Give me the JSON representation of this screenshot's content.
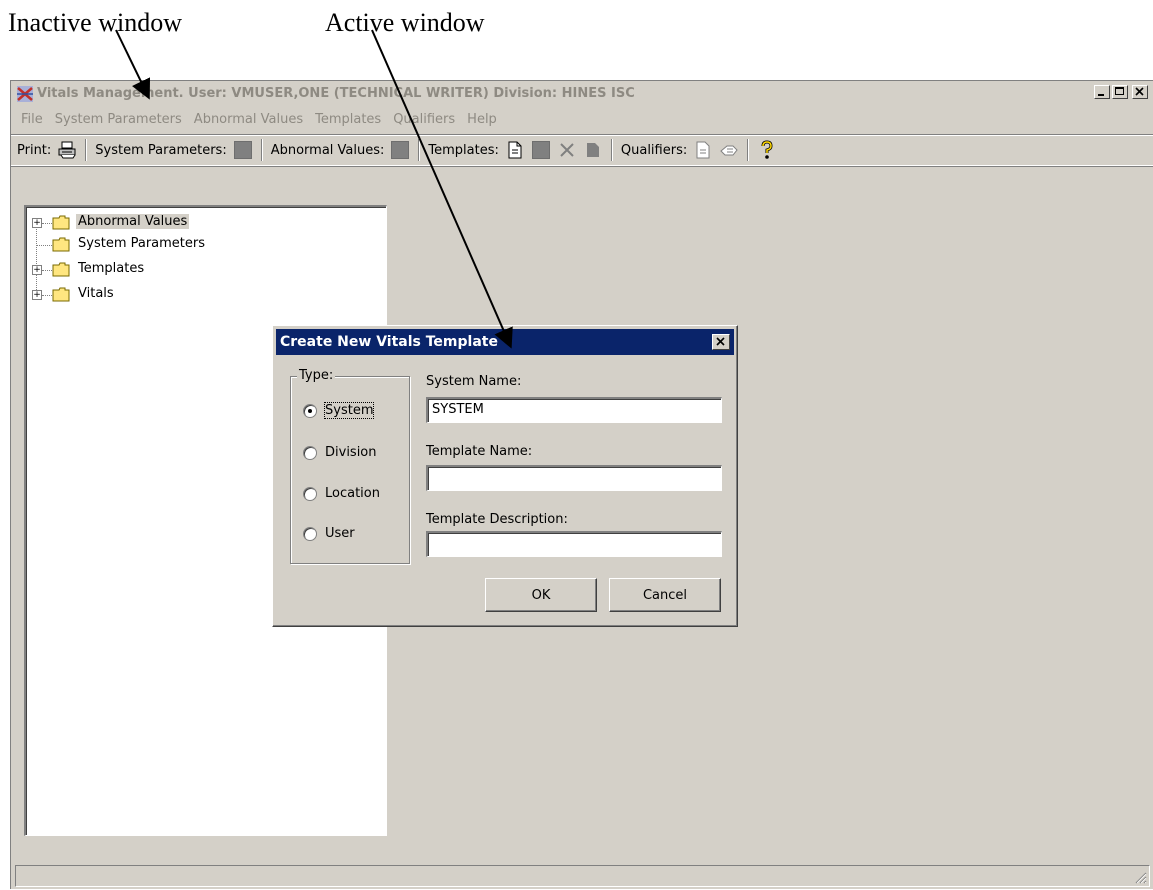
{
  "annotations": {
    "inactive": "Inactive window",
    "active": "Active window"
  },
  "main_window": {
    "title": "Vitals Management. User: VMUSER,ONE  (TECHNICAL WRITER) Division: HINES ISC",
    "title_color": "#8e8a82",
    "window_buttons": [
      "minimize-icon",
      "maximize-icon",
      "close-icon"
    ],
    "menu": [
      "File",
      "System Parameters",
      "Abnormal Values",
      "Templates",
      "Qualifiers",
      "Help"
    ],
    "toolbar": {
      "print_label": "Print:",
      "system_parameters_label": "System Parameters:",
      "abnormal_values_label": "Abnormal Values:",
      "templates_label": "Templates:",
      "qualifiers_label": "Qualifiers:",
      "icons": [
        "printer-icon",
        "gray-square-icon",
        "gray-square-icon",
        "new-document-icon",
        "gray-square-icon",
        "delete-x-icon",
        "document-icon",
        "document-icon",
        "hand-icon",
        "help-icon"
      ]
    },
    "tree": [
      {
        "label": "Abnormal Values",
        "expandable": true,
        "selected": true
      },
      {
        "label": "System Parameters",
        "expandable": false,
        "selected": false
      },
      {
        "label": "Templates",
        "expandable": true,
        "selected": false
      },
      {
        "label": "Vitals",
        "expandable": true,
        "selected": false
      }
    ]
  },
  "dialog": {
    "title": "Create New Vitals Template",
    "title_bar_color": "#0a246a",
    "type_group_label": "Type:",
    "type_options": [
      {
        "label": "System",
        "checked": true
      },
      {
        "label": "Division",
        "checked": false
      },
      {
        "label": "Location",
        "checked": false
      },
      {
        "label": "User",
        "checked": false
      }
    ],
    "system_name_label": "System Name:",
    "system_name_value": "SYSTEM",
    "template_name_label": "Template Name:",
    "template_name_value": "",
    "template_description_label": "Template Description:",
    "template_description_value": "",
    "ok_label": "OK",
    "cancel_label": "Cancel"
  }
}
